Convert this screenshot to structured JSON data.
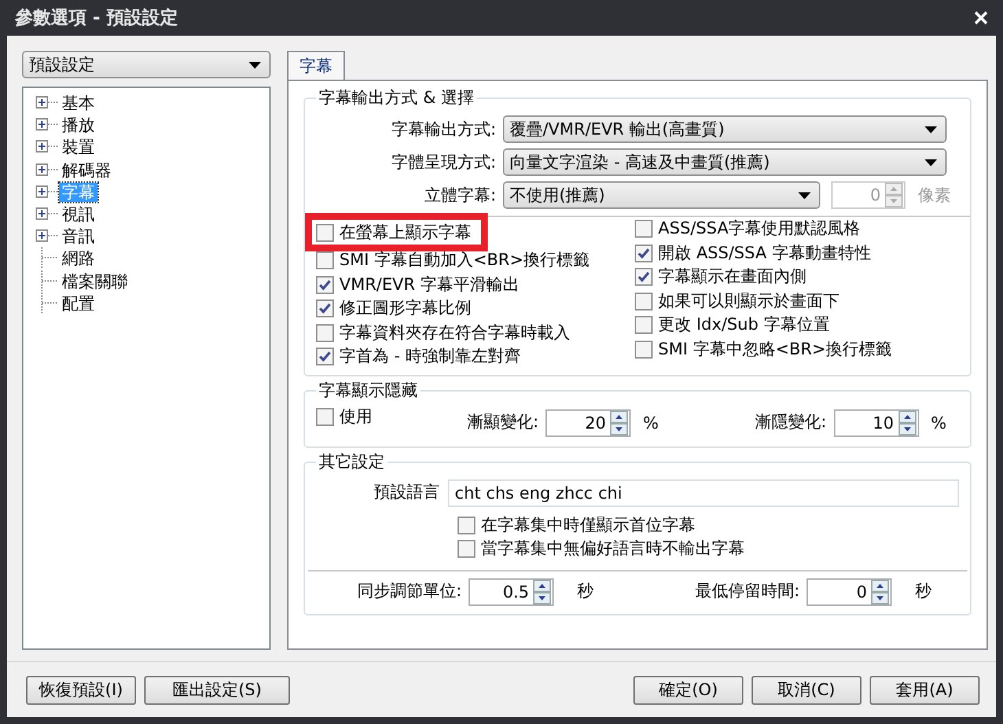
{
  "window": {
    "title": "參數選項 - 預設設定"
  },
  "profile_select": {
    "value": "預設設定"
  },
  "tree": {
    "items": [
      {
        "label": "基本",
        "expandable": true,
        "selected": false
      },
      {
        "label": "播放",
        "expandable": true,
        "selected": false
      },
      {
        "label": "裝置",
        "expandable": true,
        "selected": false
      },
      {
        "label": "解碼器",
        "expandable": true,
        "selected": false
      },
      {
        "label": "字幕",
        "expandable": true,
        "selected": true
      },
      {
        "label": "視訊",
        "expandable": true,
        "selected": false
      },
      {
        "label": "音訊",
        "expandable": true,
        "selected": false
      },
      {
        "label": "網路",
        "expandable": false,
        "selected": false
      },
      {
        "label": "檔案關聯",
        "expandable": false,
        "selected": false
      },
      {
        "label": "配置",
        "expandable": false,
        "selected": false
      }
    ]
  },
  "tabs": [
    {
      "label": "字幕",
      "selected": true
    }
  ],
  "output_group": {
    "title": "字幕輸出方式 & 選擇",
    "fields": [
      {
        "label": "字幕輸出方式:",
        "value": "覆疊/VMR/EVR 輸出(高畫質)"
      },
      {
        "label": "字體呈現方式:",
        "value": "向量文字渲染 - 高速及中畫質(推薦)"
      },
      {
        "label": "立體字幕:",
        "value": "不使用(推薦)"
      }
    ],
    "depth_spin": {
      "value": "0",
      "unit": "像素",
      "disabled": true
    },
    "checkbox_columns": [
      {
        "items": [
          {
            "label": "在螢幕上顯示字幕",
            "checked": false,
            "highlighted": true
          },
          {
            "label": "SMI 字幕自動加入<BR>換行標籤",
            "checked": false,
            "highlighted": false
          },
          {
            "label": "VMR/EVR 字幕平滑輸出",
            "checked": true,
            "highlighted": false
          },
          {
            "label": "修正圖形字幕比例",
            "checked": true,
            "highlighted": false
          },
          {
            "label": "字幕資料夾存在符合字幕時載入",
            "checked": false,
            "highlighted": false
          },
          {
            "label": "字首為 - 時強制靠左對齊",
            "checked": true,
            "highlighted": false
          }
        ]
      },
      {
        "items": [
          {
            "label": "ASS/SSA字幕使用默認風格",
            "checked": false,
            "highlighted": false
          },
          {
            "label": "開啟 ASS/SSA 字幕動畫特性",
            "checked": true,
            "highlighted": false
          },
          {
            "label": "字幕顯示在畫面內側",
            "checked": true,
            "highlighted": false
          },
          {
            "label": "如果可以則顯示於畫面下",
            "checked": false,
            "highlighted": false
          },
          {
            "label": "更改 Idx/Sub 字幕位置",
            "checked": false,
            "highlighted": false
          },
          {
            "label": "SMI 字幕中忽略<BR>換行標籤",
            "checked": false,
            "highlighted": false
          }
        ]
      }
    ]
  },
  "fade_group": {
    "title": "字幕顯示隱藏",
    "use": {
      "label": "使用",
      "checked": false
    },
    "spins": [
      {
        "label": "漸顯變化:",
        "value": "20",
        "unit": "%"
      },
      {
        "label": "漸隱變化:",
        "value": "10",
        "unit": "%"
      }
    ]
  },
  "other_group": {
    "title": "其它設定",
    "language": {
      "label": "預設語言",
      "value": "cht chs eng zhcc chi"
    },
    "checkboxes": [
      {
        "label": "在字幕集中時僅顯示首位字幕",
        "checked": false
      },
      {
        "label": "當字幕集中無偏好語言時不輸出字幕",
        "checked": false
      }
    ],
    "spins": [
      {
        "label": "同步調節單位:",
        "value": "0.5",
        "unit": "秒"
      },
      {
        "label": "最低停留時間:",
        "value": "0",
        "unit": "秒"
      }
    ]
  },
  "buttons_left": [
    "恢復預設(I)",
    "匯出設定(S)"
  ],
  "buttons_right": [
    "確定(O)",
    "取消(C)",
    "套用(A)"
  ]
}
